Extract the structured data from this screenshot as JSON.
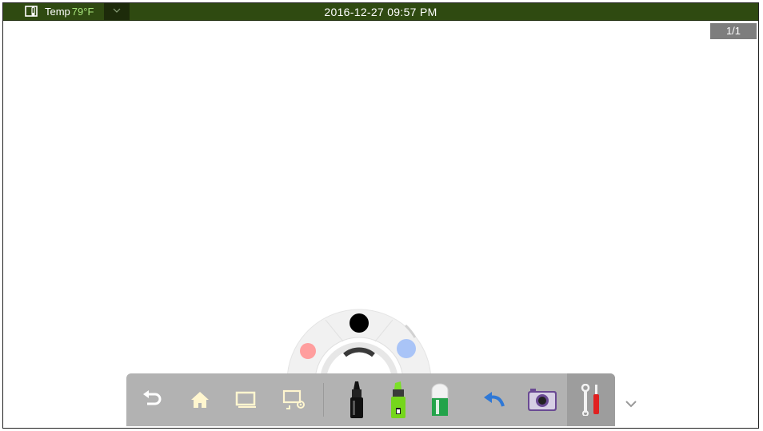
{
  "status_bar": {
    "temp_label": "Temp",
    "temp_value": "79°F",
    "datetime": "2016-12-27  09:57  PM"
  },
  "page_indicator": "1/1",
  "pen_wheel": {
    "colors": {
      "black": "#000000",
      "red": "#ff9e9e",
      "blue": "#a9c4f7"
    }
  },
  "toolbar": {
    "buttons": [
      {
        "name": "back",
        "icon": "back-arrow-icon"
      },
      {
        "name": "home",
        "icon": "home-icon"
      },
      {
        "name": "window",
        "icon": "window-icon"
      },
      {
        "name": "display-settings",
        "icon": "display-settings-icon"
      },
      {
        "name": "marker",
        "icon": "marker-pen-icon"
      },
      {
        "name": "highlighter",
        "icon": "highlighter-icon"
      },
      {
        "name": "eraser",
        "icon": "eraser-icon"
      },
      {
        "name": "undo",
        "icon": "undo-icon"
      },
      {
        "name": "camera",
        "icon": "camera-icon"
      },
      {
        "name": "tools",
        "icon": "tools-icon"
      }
    ],
    "expand_icon": "chevron-down-icon"
  },
  "colors": {
    "status_bar": "#2f4a11",
    "temp_value": "#a7e37b",
    "toolbar": "#b2b2b2",
    "page_indicator": "#7d7d7d"
  }
}
